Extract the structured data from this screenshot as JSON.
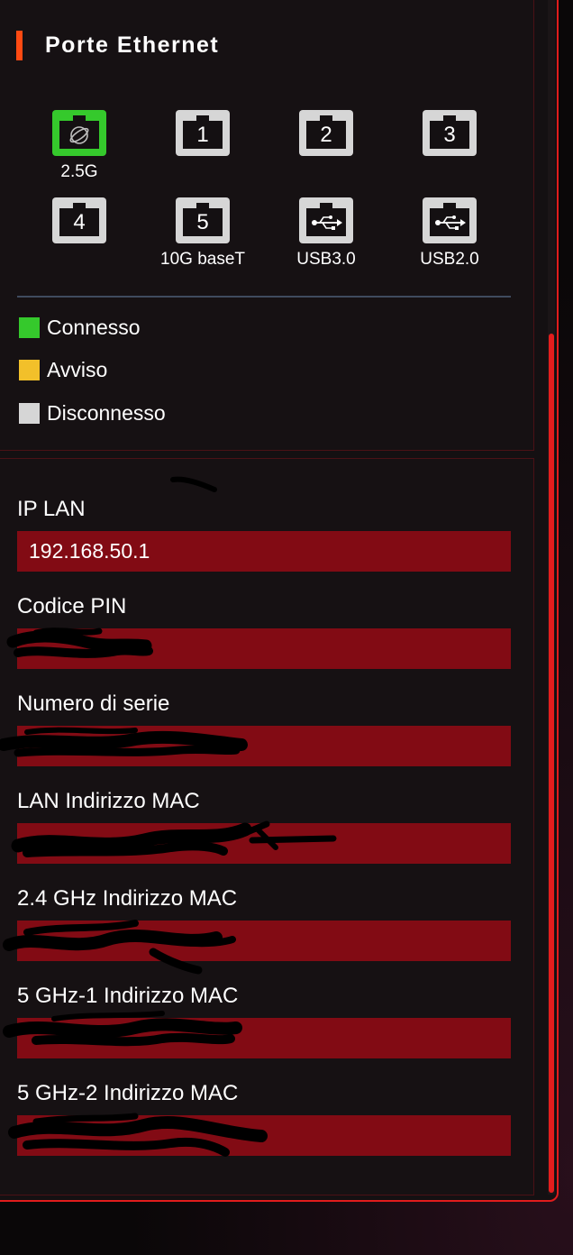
{
  "ports_section": {
    "title": "Porte Ethernet",
    "ports": [
      {
        "id": "wan",
        "label": "2.5G",
        "status": "connected",
        "icon": "globe-icon"
      },
      {
        "id": "1",
        "number": "1",
        "label": "",
        "status": "disconnected"
      },
      {
        "id": "2",
        "number": "2",
        "label": "",
        "status": "disconnected"
      },
      {
        "id": "3",
        "number": "3",
        "label": "",
        "status": "disconnected"
      },
      {
        "id": "4",
        "number": "4",
        "label": "",
        "status": "disconnected"
      },
      {
        "id": "5",
        "number": "5",
        "label": "10G baseT",
        "status": "disconnected"
      },
      {
        "id": "usb3",
        "label": "USB3.0",
        "status": "disconnected",
        "icon": "usb-icon"
      },
      {
        "id": "usb2",
        "label": "USB2.0",
        "status": "disconnected",
        "icon": "usb-icon"
      }
    ],
    "legend": [
      {
        "label": "Connesso",
        "color": "#35c92c"
      },
      {
        "label": "Avviso",
        "color": "#f2c02a"
      },
      {
        "label": "Disconnesso",
        "color": "#d6d6d6"
      }
    ]
  },
  "info_section": {
    "fields": [
      {
        "label": "IP LAN",
        "value": "192.168.50.1"
      },
      {
        "label": "Codice PIN",
        "value": ""
      },
      {
        "label": "Numero di serie",
        "value": ""
      },
      {
        "label": "LAN Indirizzo MAC",
        "value": ""
      },
      {
        "label": "2.4 GHz Indirizzo MAC",
        "value": ""
      },
      {
        "label": "5 GHz-1 Indirizzo MAC",
        "value": ""
      },
      {
        "label": "5 GHz-2 Indirizzo MAC",
        "value": ""
      }
    ]
  },
  "colors": {
    "accent": "#e11c1c",
    "title_marker": "#ff4a12",
    "field_background": "#820b14",
    "connected": "#35c92c",
    "warning": "#f2c02a",
    "disconnected": "#d6d6d6"
  }
}
